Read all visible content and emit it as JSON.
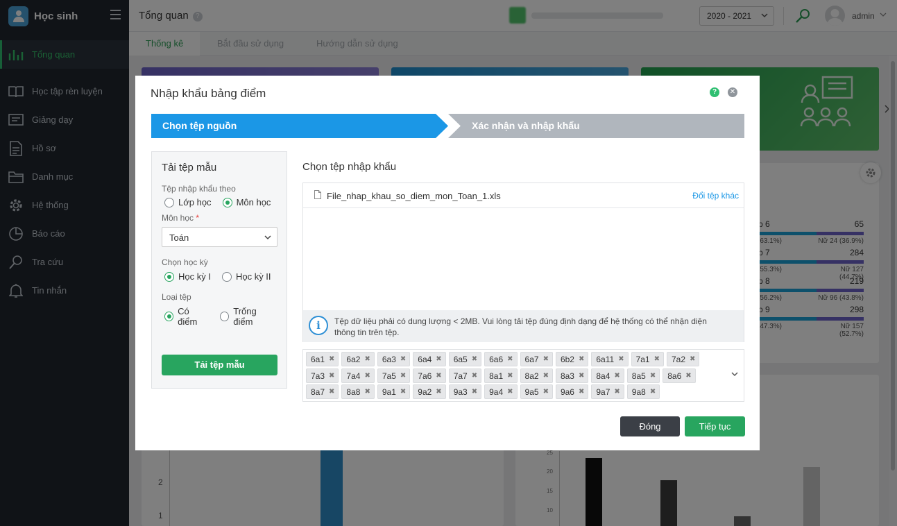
{
  "app": {
    "title": "Học sinh"
  },
  "sidebar": {
    "items": [
      {
        "label": "Tổng quan",
        "icon": "bar-chart-icon",
        "active": true
      },
      {
        "label": "Học tập rèn luyện",
        "icon": "book-icon"
      },
      {
        "label": "Giảng dạy",
        "icon": "board-icon"
      },
      {
        "label": "Hồ sơ",
        "icon": "document-icon"
      },
      {
        "label": "Danh mục",
        "icon": "folder-icon"
      },
      {
        "label": "Hệ thống",
        "icon": "gear-icon"
      },
      {
        "label": "Báo cáo",
        "icon": "pie-chart-icon"
      },
      {
        "label": "Tra cứu",
        "icon": "search-icon"
      },
      {
        "label": "Tin nhắn",
        "icon": "bell-icon"
      }
    ]
  },
  "header": {
    "page_title": "Tổng quan",
    "year": "2020 - 2021",
    "user": "admin"
  },
  "tabs": [
    {
      "label": "Thống kê",
      "active": true
    },
    {
      "label": "Bắt đầu sử dụng"
    },
    {
      "label": "Hướng dẫn sử dụng"
    }
  ],
  "background_stats": {
    "rows": [
      {
        "label": "p 6",
        "total": "65",
        "left": "(63.1%)",
        "right": "Nữ 24 (36.9%)"
      },
      {
        "label": "p 7",
        "total": "284",
        "left": "(55.3%)",
        "right": "Nữ 127 (44.7%)"
      },
      {
        "label": "p 8",
        "total": "219",
        "left": "(56.2%)",
        "right": "Nữ 96 (43.8%)"
      },
      {
        "label": "p 9",
        "total": "298",
        "left": "(47.3%)",
        "right": "Nữ 157 (52.7%)"
      }
    ],
    "left_axis": [
      "2",
      "1"
    ],
    "right_axis": [
      "25",
      "20",
      "15",
      "10"
    ]
  },
  "modal": {
    "title": "Nhập khẩu bảng điểm",
    "steps": [
      "Chọn tệp nguồn",
      "Xác nhận và nhập khẩu"
    ],
    "template": {
      "title": "Tải tệp mẫu",
      "import_by_label": "Tệp nhập khẩu theo",
      "import_by_options": [
        "Lớp học",
        "Môn học"
      ],
      "import_by_selected": 1,
      "subject_label": "Môn học",
      "subject_required": "*",
      "subject_value": "Toán",
      "semester_label": "Chọn học kỳ",
      "semester_options": [
        "Học kỳ I",
        "Học kỳ II"
      ],
      "semester_selected": 0,
      "type_label": "Loại tệp",
      "type_options": [
        "Có điểm",
        "Trống điểm"
      ],
      "type_selected": 0,
      "download_button": "Tải tệp mẫu"
    },
    "import": {
      "title": "Chọn tệp nhập khẩu",
      "file_name": "File_nhap_khau_so_diem_mon_Toan_1.xls",
      "change_file": "Đổi tệp khác",
      "info_text": "Tệp dữ liệu phải có dung lượng < 2MB. Vui lòng tải tệp đúng định dạng để hệ thống có thể nhận diện thông tin trên tệp."
    },
    "classes": [
      "6a1",
      "6a2",
      "6a3",
      "6a4",
      "6a5",
      "6a6",
      "6a7",
      "6b2",
      "6a11",
      "7a1",
      "7a2",
      "7a3",
      "7a4",
      "7a5",
      "7a6",
      "7a7",
      "8a1",
      "8a2",
      "8a3",
      "8a4",
      "8a5",
      "8a6",
      "8a7",
      "8a8",
      "9a1",
      "9a2",
      "9a3",
      "9a4",
      "9a5",
      "9a6",
      "9a7",
      "9a8"
    ],
    "buttons": {
      "close": "Đóng",
      "next": "Tiếp tục"
    }
  },
  "colors": {
    "primary_green": "#28a55f",
    "step_blue": "#1b97e6",
    "sidebar_bg": "#20262f"
  }
}
